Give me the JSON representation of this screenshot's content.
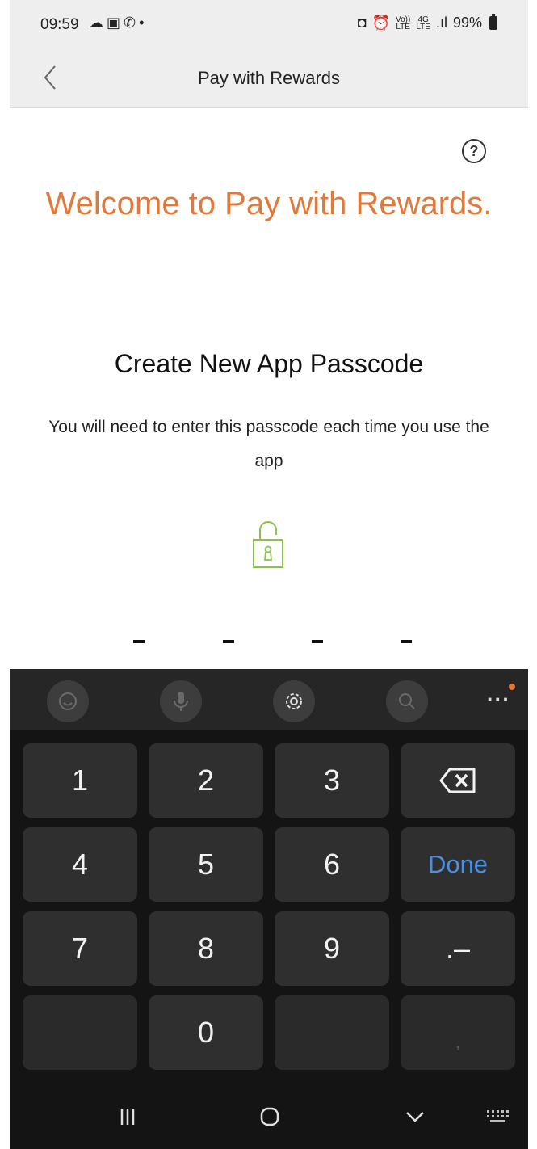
{
  "status_bar": {
    "time": "09:59",
    "left_icons": [
      "cloud-icon",
      "gallery-icon",
      "whatsapp-icon",
      "dot-icon"
    ],
    "vo_lte": "Vo))",
    "lte": "LTE",
    "network_4g": "4G",
    "network_type": "LTE",
    "battery": "99%"
  },
  "header": {
    "title": "Pay with Rewards",
    "back_icon": "chevron-left-icon"
  },
  "main": {
    "help_icon": "?",
    "welcome": "Welcome to Pay with Rewards.",
    "heading": "Create New App Passcode",
    "description": "You will need to enter this passcode each time you use the app",
    "passcode_slots": 4
  },
  "keyboard": {
    "toolbar": [
      "emoji-icon",
      "mic-icon",
      "settings-icon",
      "search-icon",
      "more-icon"
    ],
    "keys": {
      "k1": "1",
      "k2": "2",
      "k3": "3",
      "k4": "4",
      "k5": "5",
      "k6": "6",
      "k7": "7",
      "k8": "8",
      "k9": "9",
      "k0": "0",
      "done": "Done",
      "dot_dash": ".–",
      "comma": ","
    }
  },
  "colors": {
    "accent": "#e07a3c",
    "lock": "#8bc34a",
    "done_key": "#4a90e2"
  }
}
